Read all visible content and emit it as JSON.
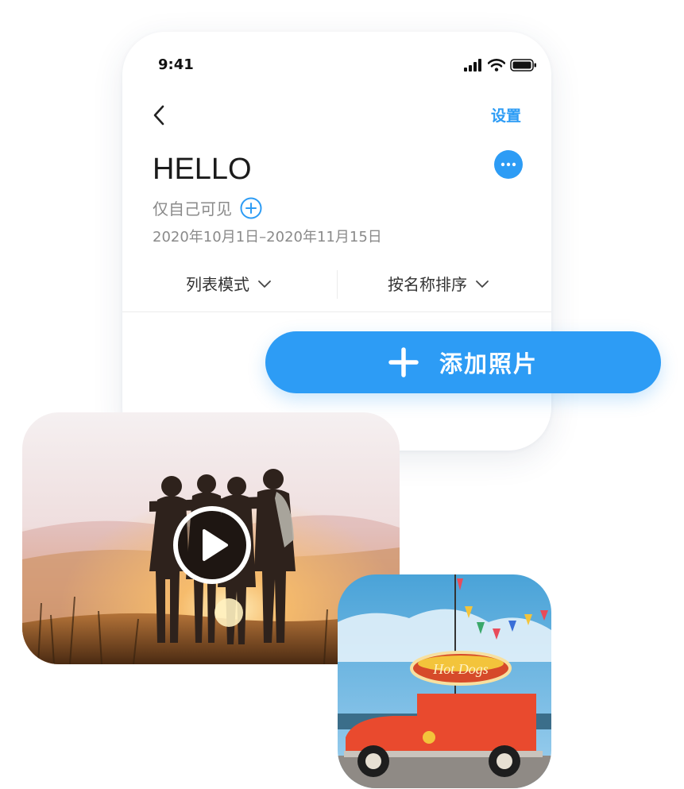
{
  "status_bar": {
    "time": "9:41"
  },
  "nav": {
    "settings_label": "设置"
  },
  "album": {
    "title": "HELLO",
    "privacy": "仅自己可见",
    "date_range": "2020年10月1日–2020年11月15日"
  },
  "filters": {
    "view_mode": "列表模式",
    "sort": "按名称排序"
  },
  "actions": {
    "add_photo_label": "添加照片"
  },
  "colors": {
    "accent": "#2d9cf5",
    "text_muted": "#8a8a8a"
  },
  "icons": {
    "back": "chevron-left-icon",
    "more": "ellipsis-icon",
    "add": "plus-circle-icon",
    "dropdown": "chevron-down-icon",
    "play": "play-icon"
  }
}
